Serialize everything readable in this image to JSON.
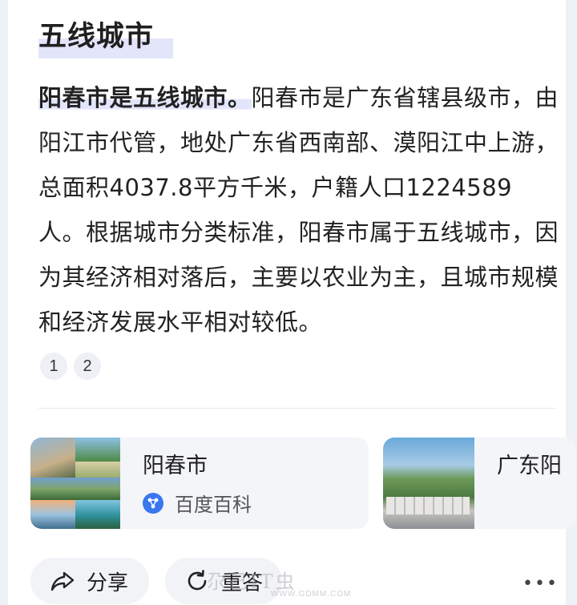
{
  "heading": "五线城市",
  "answer": {
    "lead": "阳春市是五线城市。",
    "text": "阳春市是广东省辖县级市，由阳江市代管，地处广东省西南部、漠阳江中上游，总面积4037.8平方千米，户籍人口1224589人。根据城市分类标准，阳春市属于五线城市，因为其经济相对落后，主要以农业为主，且城市规模和经济发展水平相对较低。"
  },
  "references": [
    "1",
    "2"
  ],
  "sources": [
    {
      "title": "阳春市",
      "source": "百度百科",
      "source_icon": "baike-icon"
    },
    {
      "title": "广东阳"
    }
  ],
  "actions": {
    "share_label": "分享",
    "redo_label": "重答",
    "more_label": "•••"
  },
  "watermark": {
    "text": "尕己IT虫",
    "url": "WWW.GDMM.COM"
  },
  "colors": {
    "highlight": "#e3e6fb",
    "accent": "#3a76f0",
    "background": "#eef1f6"
  }
}
